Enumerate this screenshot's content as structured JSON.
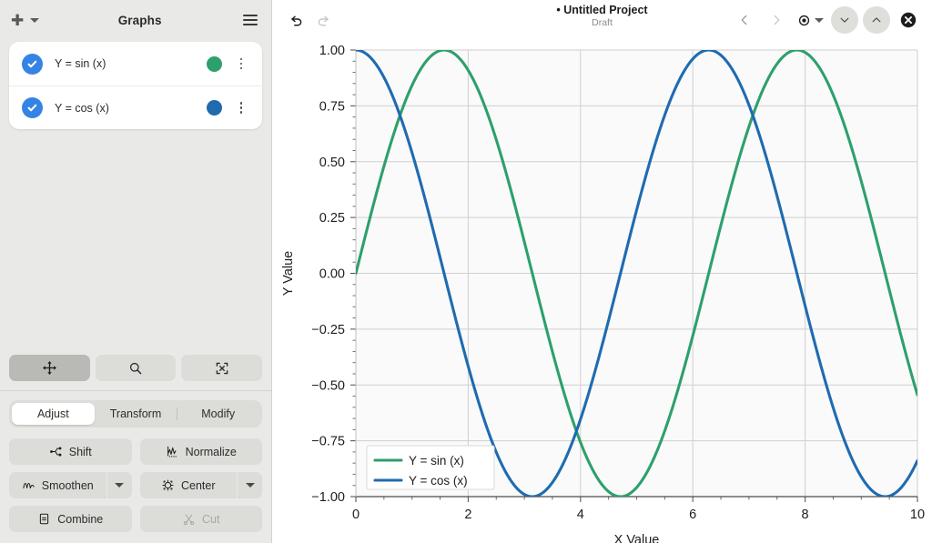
{
  "sidebar": {
    "title": "Graphs",
    "add_button": "+",
    "add_icon": "plus-icon",
    "add_caret_icon": "chevron-down-icon",
    "menu_icon": "hamburger-menu-icon",
    "graphs": [
      {
        "label": "Y = sin (x)",
        "color": "#2ea06b",
        "checked": true,
        "check_icon": "checkmark-icon",
        "menu_icon": "kebab-menu-icon"
      },
      {
        "label": "Y = cos (x)",
        "color": "#1f6bb0",
        "checked": true,
        "check_icon": "checkmark-icon",
        "menu_icon": "kebab-menu-icon"
      }
    ],
    "modes": [
      {
        "name": "pan-mode",
        "icon": "move-arrows-icon",
        "active": true
      },
      {
        "name": "zoom-mode",
        "icon": "magnifier-icon",
        "active": false
      },
      {
        "name": "select-mode",
        "icon": "select-region-icon",
        "active": false
      }
    ],
    "tabs": [
      {
        "label": "Adjust",
        "active": true
      },
      {
        "label": "Transform",
        "active": false
      },
      {
        "label": "Modify",
        "active": false
      }
    ],
    "actions": [
      {
        "label": "Shift",
        "icon": "shift-icon",
        "disabled": false,
        "split": false
      },
      {
        "label": "Normalize",
        "icon": "normalize-icon",
        "disabled": false,
        "split": false
      },
      {
        "label": "Smoothen",
        "icon": "smoothen-icon",
        "disabled": false,
        "split": true
      },
      {
        "label": "Center",
        "icon": "center-icon",
        "disabled": false,
        "split": true
      },
      {
        "label": "Combine",
        "icon": "combine-icon",
        "disabled": false,
        "split": false
      },
      {
        "label": "Cut",
        "icon": "scissors-icon",
        "disabled": true,
        "split": false
      }
    ]
  },
  "header": {
    "undo_icon": "undo-arrow-icon",
    "redo_icon": "redo-arrow-icon",
    "title": "• Untitled Project",
    "subtitle": "Draft",
    "prev_icon": "chevron-left-icon",
    "next_icon": "chevron-right-icon",
    "view_icon": "eye-target-icon",
    "view_caret_icon": "chevron-down-icon",
    "collapse_icon": "chevron-down-icon",
    "expand_icon": "chevron-up-icon",
    "close_icon": "close-circle-icon"
  },
  "chart_data": {
    "type": "line",
    "title": "",
    "xlabel": "X Value",
    "ylabel": "Y Value",
    "xlim": [
      0,
      10
    ],
    "ylim": [
      -1.0,
      1.0
    ],
    "xticks": [
      0,
      2,
      4,
      6,
      8,
      10
    ],
    "xtick_labels": [
      "0",
      "2",
      "4",
      "6",
      "8",
      "10"
    ],
    "yticks": [
      1.0,
      0.75,
      0.5,
      0.25,
      0.0,
      -0.25,
      -0.5,
      -0.75,
      -1.0
    ],
    "ytick_labels": [
      "1.00",
      "0.75",
      "0.50",
      "0.25",
      "0.00",
      "−0.25",
      "−0.50",
      "−0.75",
      "−1.00"
    ],
    "grid": true,
    "legend_position": "lower left",
    "series": [
      {
        "name": "Y = sin (x)",
        "color": "#2ea06b",
        "function": "sin",
        "x": [
          0,
          0.5,
          1,
          1.5708,
          2,
          2.5,
          3,
          3.1416,
          3.5,
          4,
          4.5,
          4.7124,
          5,
          5.5,
          6,
          6.2832,
          6.5,
          7,
          7.5,
          7.854,
          8,
          8.5,
          9,
          9.4248,
          9.5,
          10
        ],
        "y": [
          0,
          0.479,
          0.841,
          1.0,
          0.909,
          0.599,
          0.141,
          0,
          -0.351,
          -0.757,
          -0.978,
          -1.0,
          -0.959,
          -0.706,
          -0.279,
          0,
          0.215,
          0.657,
          0.938,
          1.0,
          0.989,
          0.798,
          0.412,
          0,
          -0.075,
          -0.544
        ]
      },
      {
        "name": "Y = cos (x)",
        "color": "#1f6bb0",
        "function": "cos",
        "x": [
          0,
          0.5,
          1,
          1.5708,
          2,
          2.5,
          3,
          3.1416,
          3.5,
          4,
          4.5,
          4.7124,
          5,
          5.5,
          6,
          6.2832,
          6.5,
          7,
          7.5,
          7.854,
          8,
          8.5,
          9,
          9.4248,
          9.5,
          10
        ],
        "y": [
          1.0,
          0.878,
          0.54,
          0,
          -0.416,
          -0.801,
          -0.99,
          -1.0,
          -0.936,
          -0.654,
          -0.211,
          0,
          0.284,
          0.709,
          0.96,
          1.0,
          0.977,
          0.754,
          0.347,
          0,
          -0.146,
          -0.602,
          -0.911,
          -1.0,
          -0.997,
          -0.839
        ]
      }
    ]
  }
}
